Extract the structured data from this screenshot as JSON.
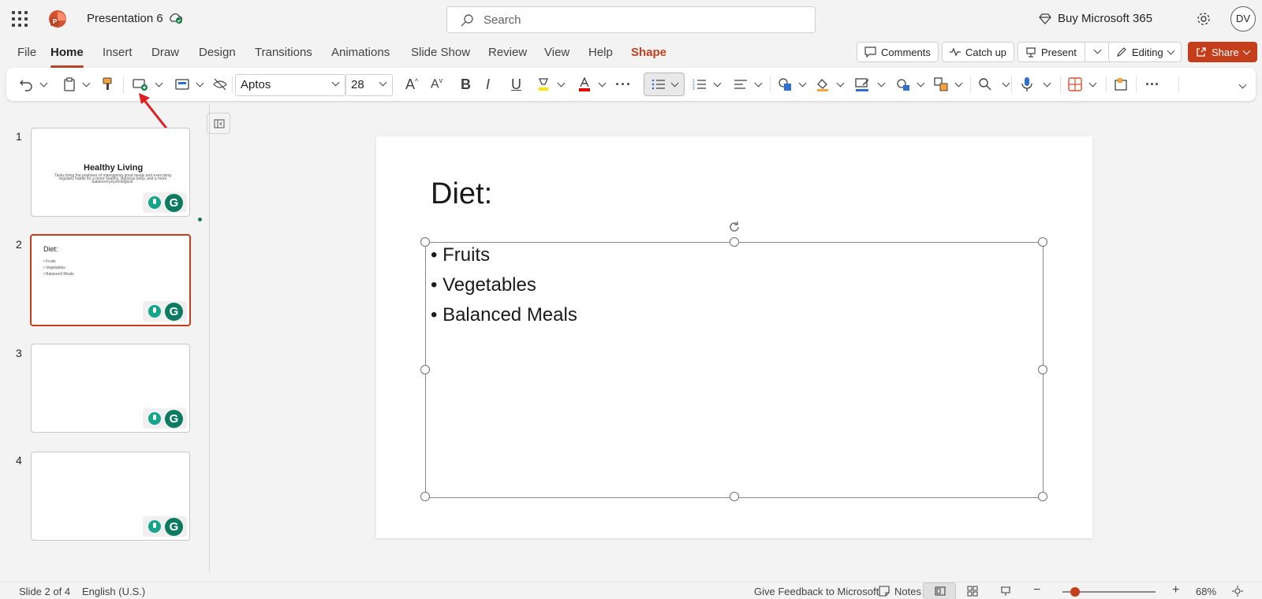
{
  "app": {
    "title": "Presentation 6",
    "search_placeholder": "Search",
    "buy": "Buy Microsoft 365",
    "avatar": "DV",
    "accent": "#c43e1c"
  },
  "tabs": [
    "File",
    "Home",
    "Insert",
    "Draw",
    "Design",
    "Transitions",
    "Animations",
    "Slide Show",
    "Review",
    "View",
    "Help",
    "Shape"
  ],
  "active_tab": "Home",
  "actions": {
    "comments": "Comments",
    "catch_up": "Catch up",
    "present": "Present",
    "editing": "Editing",
    "share": "Share"
  },
  "ribbon": {
    "font_name": "Aptos",
    "font_size": "28"
  },
  "thumbnails": [
    {
      "num": "1",
      "title": "Healthy Living",
      "subtitle": "Tasks bring the positives of maintaining good meals and exercising regularly habits for a more healthy, vigorous body, and a more balanced psychological."
    },
    {
      "num": "2",
      "title": "Diet:",
      "bullets": [
        "• Fruits",
        "• Vegetables",
        "• Balanced Meals"
      ]
    },
    {
      "num": "3"
    },
    {
      "num": "4"
    }
  ],
  "slide": {
    "title": "Diet:",
    "bullets": [
      "• Fruits",
      "• Vegetables",
      "• Balanced Meals"
    ]
  },
  "status": {
    "slide_info": "Slide 2 of 4",
    "language": "English (U.S.)",
    "feedback": "Give Feedback to Microsoft",
    "notes": "Notes",
    "zoom": "68%"
  }
}
